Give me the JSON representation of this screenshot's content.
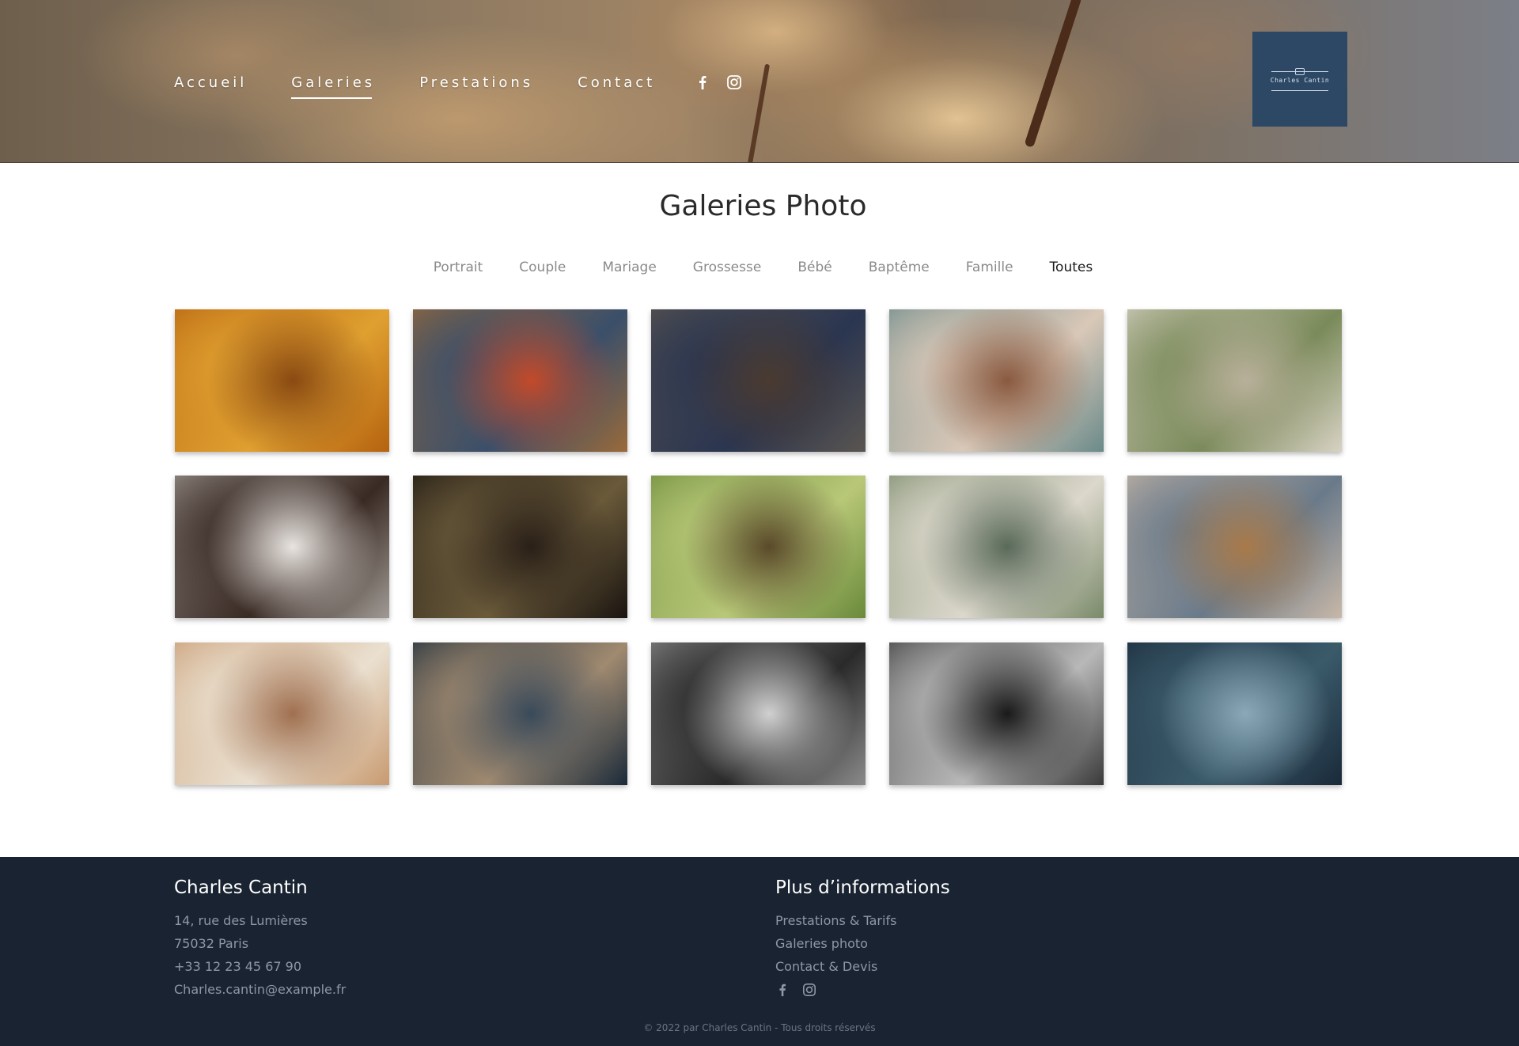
{
  "nav": {
    "items": [
      {
        "label": "Accueil",
        "active": false
      },
      {
        "label": "Galeries",
        "active": true
      },
      {
        "label": "Prestations",
        "active": false
      },
      {
        "label": "Contact",
        "active": false
      }
    ],
    "social_icons": [
      "facebook-icon",
      "instagram-icon"
    ]
  },
  "logo": {
    "text": "Charles Cantin",
    "color": "#2d4864"
  },
  "page": {
    "title": "Galeries Photo"
  },
  "filters": [
    {
      "label": "Portrait",
      "active": false
    },
    {
      "label": "Couple",
      "active": false
    },
    {
      "label": "Mariage",
      "active": false
    },
    {
      "label": "Grossesse",
      "active": false
    },
    {
      "label": "Bébé",
      "active": false
    },
    {
      "label": "Baptême",
      "active": false
    },
    {
      "label": "Famille",
      "active": false
    },
    {
      "label": "Toutes",
      "active": true
    }
  ],
  "gallery": {
    "photos": [
      {
        "name": "photo-baby-autumn-leaves",
        "colors": [
          "#b5620f",
          "#e0a030",
          "#8a4a12"
        ]
      },
      {
        "name": "photo-elderly-couple-swing",
        "colors": [
          "#9a6a3a",
          "#3a4f6a",
          "#c24a2a"
        ]
      },
      {
        "name": "photo-couple-lying-floor",
        "colors": [
          "#5a5550",
          "#2a3550",
          "#4a3a30"
        ]
      },
      {
        "name": "photo-family-bed",
        "colors": [
          "#6a8a8a",
          "#d9c8b8",
          "#8a5a40"
        ]
      },
      {
        "name": "photo-family-field",
        "colors": [
          "#d8d2c4",
          "#7a8a5a",
          "#b8b09a"
        ]
      },
      {
        "name": "photo-three-women-smiling",
        "colors": [
          "#a09a94",
          "#3a2a24",
          "#e8e4e0"
        ]
      },
      {
        "name": "photo-pregnant-woman-doorway",
        "colors": [
          "#1a1410",
          "#6a5a3a",
          "#2a2018"
        ]
      },
      {
        "name": "photo-wedding-forest",
        "colors": [
          "#6a8a3a",
          "#b8c878",
          "#5a4a2a"
        ]
      },
      {
        "name": "photo-couple-lakeside",
        "colors": [
          "#7a8a6a",
          "#dcd8cc",
          "#5a6a5a"
        ]
      },
      {
        "name": "photo-couple-bicycles-lake",
        "colors": [
          "#c8b8a8",
          "#6a7a8a",
          "#a87a4a"
        ]
      },
      {
        "name": "photo-wedding-table-flowers",
        "colors": [
          "#c89a70",
          "#eae0d0",
          "#a07050"
        ]
      },
      {
        "name": "photo-man-mustache-cap",
        "colors": [
          "#1a2a3a",
          "#a08a70",
          "#3a4a5a"
        ]
      },
      {
        "name": "photo-boy-black-white",
        "colors": [
          "#8a8a8a",
          "#2a2a2a",
          "#d0d0d0"
        ]
      },
      {
        "name": "photo-woman-black-white",
        "colors": [
          "#3a3a3a",
          "#b8b8b8",
          "#1a1a1a"
        ]
      },
      {
        "name": "photo-child-blue-shirt",
        "colors": [
          "#1a2a3a",
          "#3a5a6a",
          "#8aa8b8"
        ]
      }
    ]
  },
  "footer": {
    "left": {
      "title": "Charles Cantin",
      "lines": [
        "14, rue des Lumières",
        "75032 Paris",
        "+33 12 23 45 67 90",
        "Charles.cantin@example.fr"
      ]
    },
    "right": {
      "title": "Plus d’informations",
      "links": [
        "Prestations & Tarifs",
        "Galeries photo",
        "Contact & Devis"
      ],
      "social_icons": [
        "facebook-icon",
        "instagram-icon"
      ]
    },
    "copyright": "© 2022 par Charles Cantin - Tous droits réservés",
    "background": "#1a2331"
  }
}
